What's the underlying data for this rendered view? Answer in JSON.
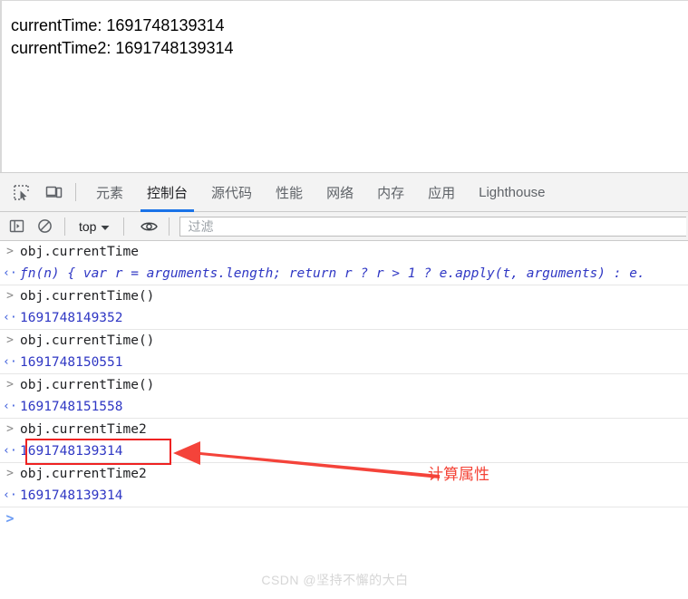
{
  "page": {
    "lines": [
      "currentTime: 1691748139314",
      "currentTime2: 1691748139314"
    ]
  },
  "devtools": {
    "toolbar_icons": [
      {
        "name": "inspect-element-icon",
        "title": "检查元素"
      },
      {
        "name": "device-toolbar-icon",
        "title": "切换设备工具栏"
      }
    ],
    "tabs": [
      {
        "label": "元素",
        "active": false
      },
      {
        "label": "控制台",
        "active": true
      },
      {
        "label": "源代码",
        "active": false
      },
      {
        "label": "性能",
        "active": false
      },
      {
        "label": "网络",
        "active": false
      },
      {
        "label": "内存",
        "active": false
      },
      {
        "label": "应用",
        "active": false
      },
      {
        "label": "Lighthouse",
        "active": false
      }
    ],
    "active_tab_color": "#1a73e8"
  },
  "console_toolbar": {
    "sidebar_toggle_name": "console-sidebar-icon",
    "clear_console_name": "clear-console-icon",
    "context_value": "top",
    "eye_toggle_name": "live-expression-icon",
    "filter_placeholder": "过滤"
  },
  "console": {
    "entries": [
      {
        "kind": "input",
        "text": "obj.currentTime",
        "group_end": false
      },
      {
        "kind": "func",
        "text": "n(n) { var r = arguments.length; return r ? r > 1 ? e.apply(t, arguments) : e.",
        "group_end": true
      },
      {
        "kind": "input",
        "text": "obj.currentTime()",
        "group_end": false
      },
      {
        "kind": "number",
        "text": "1691748149352",
        "group_end": true
      },
      {
        "kind": "input",
        "text": "obj.currentTime()",
        "group_end": false
      },
      {
        "kind": "number",
        "text": "1691748150551",
        "group_end": true
      },
      {
        "kind": "input",
        "text": "obj.currentTime()",
        "group_end": false
      },
      {
        "kind": "number",
        "text": "1691748151558",
        "group_end": true
      },
      {
        "kind": "input",
        "text": "obj.currentTime2",
        "group_end": false
      },
      {
        "kind": "number",
        "text": "1691748139314",
        "group_end": true
      },
      {
        "kind": "input",
        "text": "obj.currentTime2",
        "group_end": false
      },
      {
        "kind": "number",
        "text": "1691748139314",
        "group_end": true
      },
      {
        "kind": "prompt",
        "text": "",
        "group_end": false
      }
    ],
    "func_glyph": "ƒ",
    "input_chevron": ">",
    "output_chevron": "‹·",
    "prompt_chevron": ">"
  },
  "annotation": {
    "label": "计算属性",
    "color": "#f44336"
  },
  "watermark": {
    "text": "CSDN @坚持不懈的大白"
  }
}
